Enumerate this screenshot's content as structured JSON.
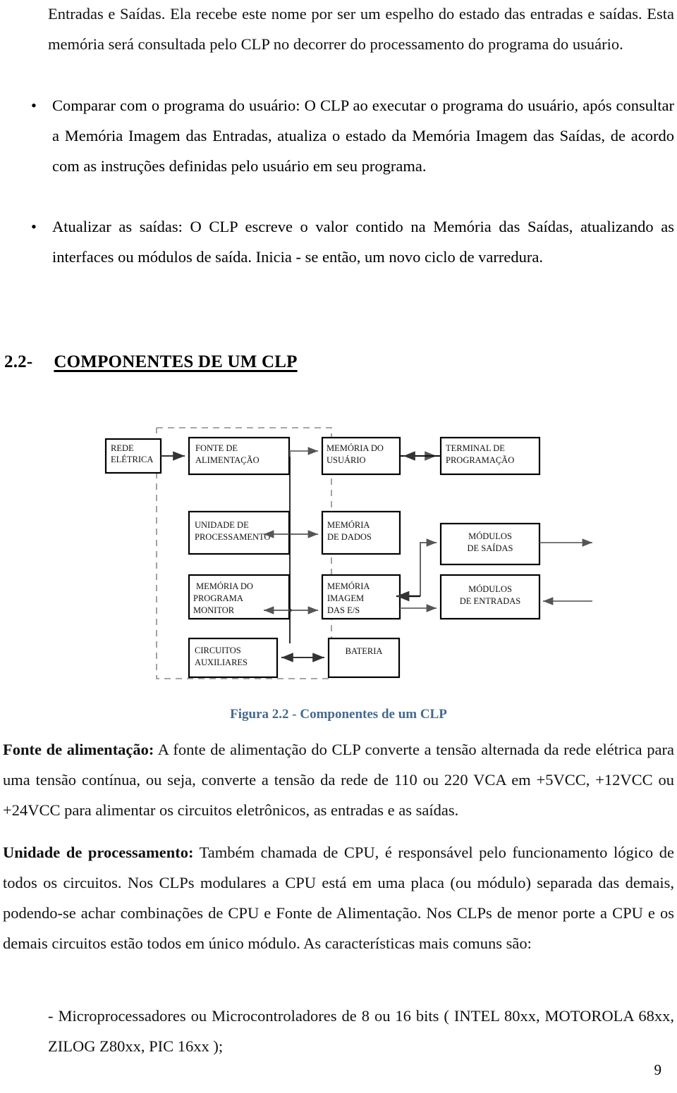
{
  "document": {
    "page_number": "9"
  },
  "intro_paragraph": {
    "text": "Entradas e Saídas. Ela recebe este nome por ser um espelho do estado das entradas e saídas. Esta memória será consultada pelo CLP no decorrer do processamento do programa do usuário."
  },
  "bullets": [
    {
      "marker": "•",
      "lead": "Comparar com o programa do usuário:",
      "body": " O CLP ao executar o programa do usuário, após consultar a Memória Imagem das Entradas, atualiza o estado da Memória Imagem das Saídas, de acordo com as instruções definidas pelo usuário em seu programa."
    },
    {
      "marker": "•",
      "lead": "Atualizar as saídas:",
      "body": " O CLP escreve o valor contido na Memória das Saídas, atualizando as interfaces ou módulos de saída. Inicia - se então, um novo ciclo de varredura."
    }
  ],
  "section": {
    "number": "2.2-",
    "title": "COMPONENTES DE UM CLP"
  },
  "figure": {
    "caption": "Figura 2.2 - Componentes de um CLP",
    "caption_color": "#46688e",
    "box_border_color": "#000000",
    "connector_color": "#555555",
    "dashed_boundary_color": "#888888",
    "boxes": [
      {
        "id": "rede-eletrica",
        "lines": [
          "REDE",
          "ELÉTRICA"
        ],
        "align": "left"
      },
      {
        "id": "fonte-alimentacao",
        "lines": [
          "FONTE DE",
          "ALIMENTAÇÃO"
        ],
        "align": "left"
      },
      {
        "id": "memoria-usuario",
        "lines": [
          "MEMÓRIA DO",
          "USUÁRIO"
        ],
        "align": "left"
      },
      {
        "id": "terminal-programacao",
        "lines": [
          "TERMINAL DE",
          "PROGRAMAÇÃO"
        ],
        "align": "left"
      },
      {
        "id": "unidade-processamento",
        "lines": [
          "UNIDADE DE",
          "PROCESSAMENTO"
        ],
        "align": "left"
      },
      {
        "id": "memoria-dados",
        "lines": [
          "MEMÓRIA",
          "DE DADOS"
        ],
        "align": "left"
      },
      {
        "id": "modulos-saidas",
        "lines": [
          "MÓDULOS",
          "DE SAÍDAS"
        ],
        "align": "center"
      },
      {
        "id": "memoria-programa-monitor",
        "lines": [
          "MEMÓRIA DO",
          "PROGRAMA",
          "MONITOR"
        ],
        "align": "left"
      },
      {
        "id": "memoria-imagem-es",
        "lines": [
          "MEMÓRIA",
          "IMAGEM",
          "DAS E/S"
        ],
        "align": "left"
      },
      {
        "id": "modulos-entradas",
        "lines": [
          "MÓDULOS",
          "DE ENTRADAS"
        ],
        "align": "center"
      },
      {
        "id": "circuitos-auxiliares",
        "lines": [
          "CIRCUITOS",
          "AUXILIARES"
        ],
        "align": "left"
      },
      {
        "id": "bateria",
        "lines": [
          "BATERIA"
        ],
        "align": "center"
      }
    ]
  },
  "body_paragraphs": [
    {
      "id": "fonte-de-alimentacao",
      "lead": "Fonte de alimentação:",
      "body": " A fonte de alimentação do CLP converte a tensão alternada da rede elétrica para uma tensão contínua, ou seja, converte a tensão da rede de 110 ou 220 VCA em +5VCC, +12VCC ou +24VCC para alimentar os circuitos eletrônicos, as entradas e as saídas."
    },
    {
      "id": "unidade-de-processamento",
      "lead": "Unidade de processamento:",
      "body": " Também chamada de CPU, é responsável pelo funcionamento lógico de todos os circuitos. Nos CLPs modulares a CPU está em uma placa (ou módulo) separada das demais, podendo-se achar combinações de CPU e Fonte de Alimentação. Nos CLPs de menor porte a CPU e os demais circuitos estão todos em único módulo. As características mais comuns são:"
    }
  ],
  "list_items": [
    {
      "id": "microprocessadores",
      "text": "- Microprocessadores ou Microcontroladores de 8 ou 16 bits ( INTEL 80xx, MOTOROLA 68xx, ZILOG Z80xx, PIC 16xx );"
    }
  ]
}
